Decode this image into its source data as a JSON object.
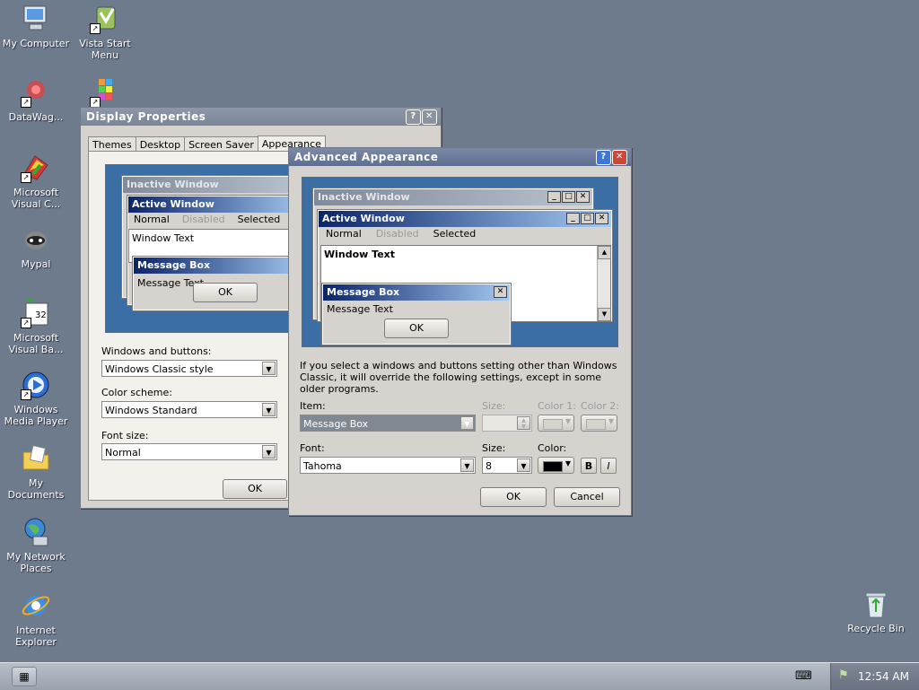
{
  "desktop": {
    "icons": [
      {
        "label": "My Computer",
        "icon": "computer-icon"
      },
      {
        "label": "Vista Start Menu",
        "icon": "vista-start-menu-icon"
      },
      {
        "label": "DataWag...",
        "icon": "datawag-icon"
      },
      {
        "label": "",
        "icon": "color-blocks-icon"
      },
      {
        "label": "Microsoft Visual C...",
        "icon": "visual-c-icon"
      },
      {
        "label": "Mypal",
        "icon": "mypal-icon"
      },
      {
        "label": "Microsoft Visual Ba...",
        "icon": "visual-basic-icon"
      },
      {
        "label": "Windows Media Player",
        "icon": "media-player-icon"
      },
      {
        "label": "My Documents",
        "icon": "documents-icon"
      },
      {
        "label": "My Network Places",
        "icon": "network-icon"
      },
      {
        "label": "Internet Explorer",
        "icon": "ie-icon"
      },
      {
        "label": "Recycle Bin",
        "icon": "recycle-bin-icon"
      }
    ]
  },
  "display_properties": {
    "title": "Display Properties",
    "tabs": [
      {
        "label": "Themes"
      },
      {
        "label": "Desktop"
      },
      {
        "label": "Screen Saver"
      },
      {
        "label": "Appearance",
        "selected": true
      }
    ],
    "preview": {
      "inactive_title": "Inactive Window",
      "active_title": "Active Window",
      "menu": [
        "Normal",
        "Disabled",
        "Selected"
      ],
      "window_text": "Window Text",
      "message_box_title": "Message Box",
      "message_text": "Message Text",
      "ok": "OK"
    },
    "windows_buttons_label": "Windows and buttons:",
    "windows_buttons_value": "Windows Classic style",
    "color_scheme_label": "Color scheme:",
    "color_scheme_value": "Windows Standard",
    "font_size_label": "Font size:",
    "font_size_value": "Normal",
    "ok": "OK"
  },
  "advanced_appearance": {
    "title": "Advanced Appearance",
    "preview": {
      "inactive_title": "Inactive Window",
      "active_title": "Active Window",
      "menu": [
        "Normal",
        "Disabled",
        "Selected"
      ],
      "window_text": "Window Text",
      "message_box_title": "Message Box",
      "message_text": "Message Text",
      "ok": "OK"
    },
    "info_text": "If you select a windows and buttons setting other than Windows Classic, it will override the following settings, except in some older programs.",
    "item_label": "Item:",
    "item_value": "Message Box",
    "size_label": "Size:",
    "color1_label": "Color 1:",
    "color2_label": "Color 2:",
    "font_label": "Font:",
    "font_value": "Tahoma",
    "font_size_label": "Size:",
    "font_size_value": "8",
    "font_color_label": "Color:",
    "font_color": "#000000",
    "bold": "B",
    "italic": "I",
    "ok": "OK",
    "cancel": "Cancel"
  },
  "taskbar": {
    "clock": "12:54 AM"
  },
  "colors": {
    "desktop": "#6d7b8d",
    "active_title_start": "#0a246a",
    "active_title_end": "#a6caf0",
    "preview_bg": "#3a6ea5"
  }
}
